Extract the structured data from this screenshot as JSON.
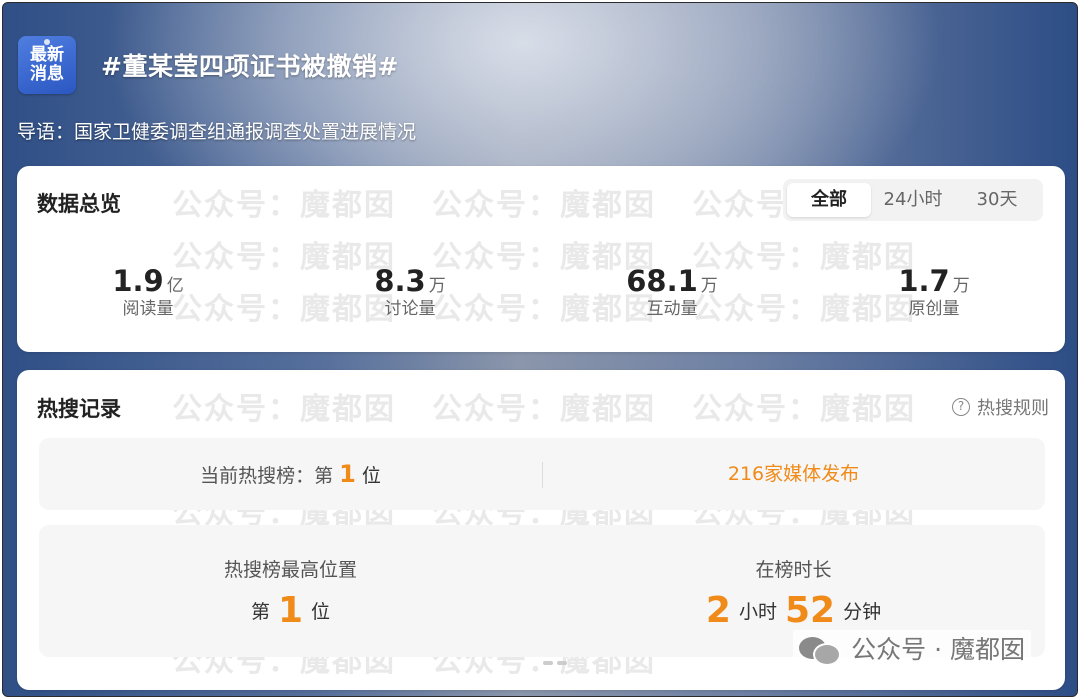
{
  "header": {
    "badge_line1": "最新",
    "badge_line2": "消息",
    "topic": "#董某莹四项证书被撤销#",
    "guide": "导语：国家卫健委调查组通报调查处置进展情况"
  },
  "overview": {
    "title": "数据总览",
    "tabs": [
      {
        "label": "全部",
        "active": true
      },
      {
        "label": "24小时",
        "active": false
      },
      {
        "label": "30天",
        "active": false
      }
    ],
    "stats": [
      {
        "value": "1.9",
        "unit": "亿",
        "label": "阅读量"
      },
      {
        "value": "8.3",
        "unit": "万",
        "label": "讨论量"
      },
      {
        "value": "68.1",
        "unit": "万",
        "label": "互动量"
      },
      {
        "value": "1.7",
        "unit": "万",
        "label": "原创量"
      }
    ]
  },
  "hot": {
    "title": "热搜记录",
    "rules_label": "热搜规则",
    "rules_icon": "question-circle-icon",
    "current_prefix": "当前热搜榜：第",
    "current_rank": "1",
    "current_suffix": "位",
    "media": "216家媒体发布",
    "peak_label": "热搜榜最高位置",
    "peak_prefix": "第",
    "peak_rank": "1",
    "peak_suffix": "位",
    "duration_label": "在榜时长",
    "duration_hours": "2",
    "duration_hours_unit": "小时",
    "duration_minutes": "52",
    "duration_minutes_unit": "分钟"
  },
  "watermark": {
    "text": "公众号：魔都囡",
    "footer": "公众号 · 魔都囡",
    "footer_icon": "wechat-icon"
  },
  "colors": {
    "accent": "#f08a19",
    "badge": "#3b6bd6"
  }
}
